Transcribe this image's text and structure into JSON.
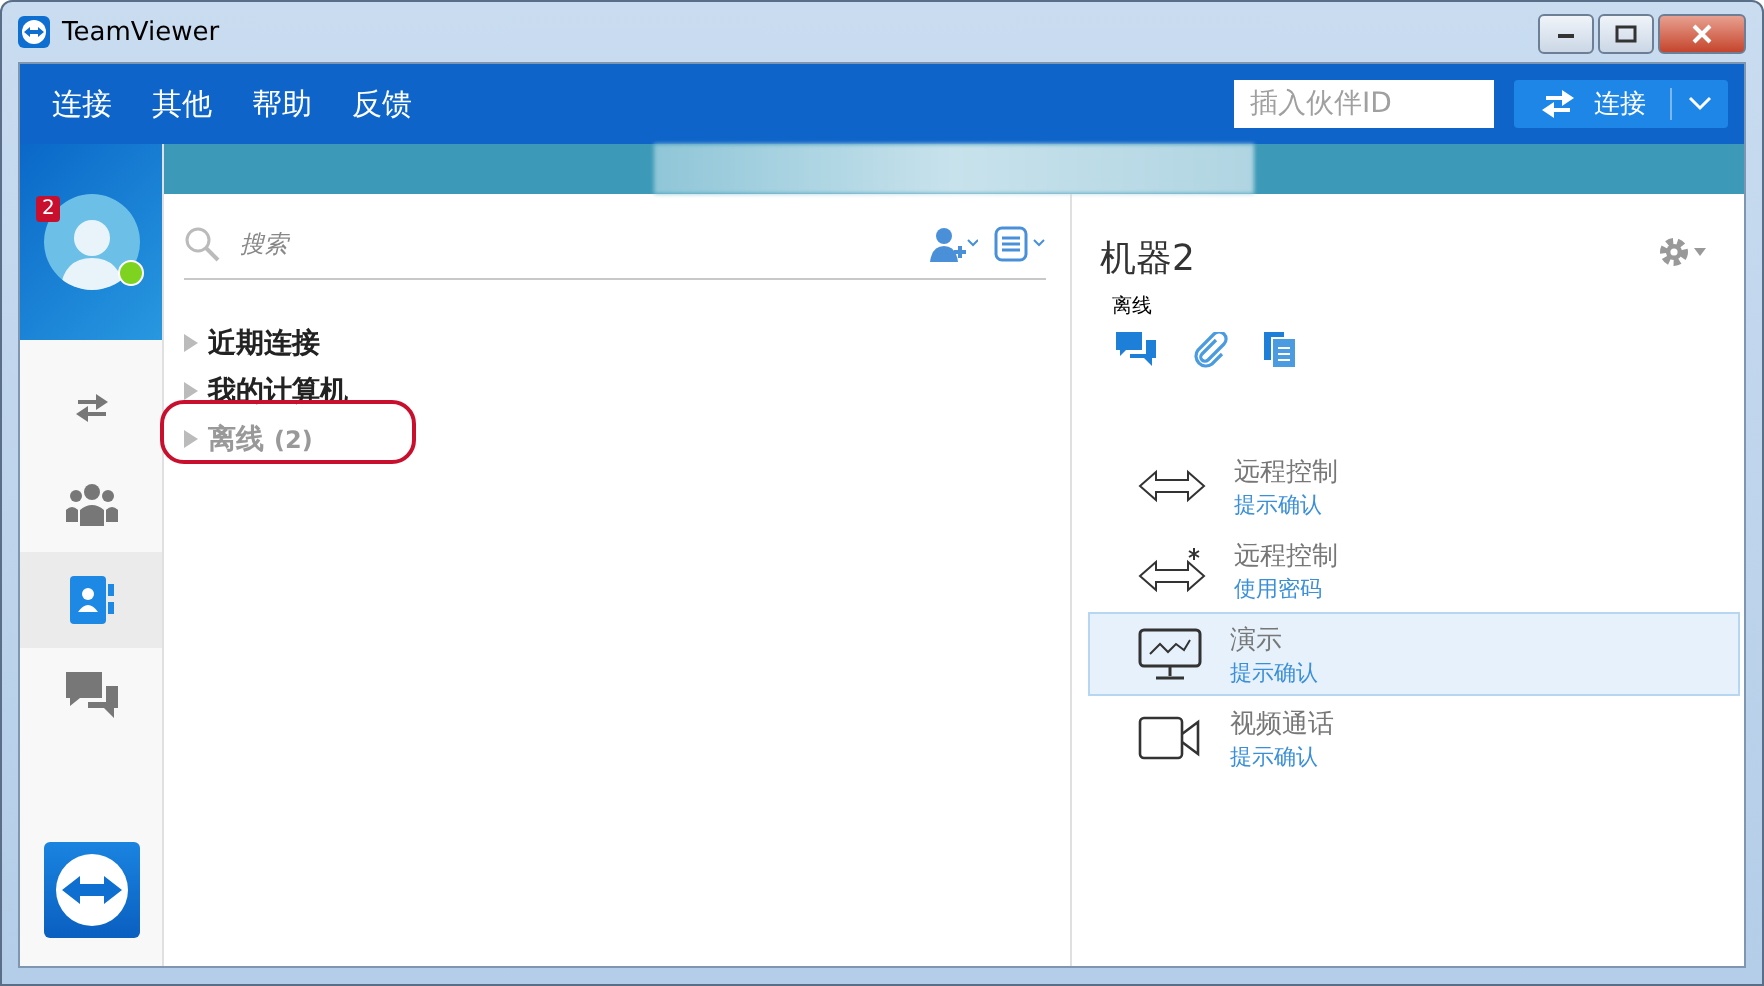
{
  "window": {
    "title": "TeamViewer"
  },
  "menu": [
    "连接",
    "其他",
    "帮助",
    "反馈"
  ],
  "partner_id": {
    "placeholder": "插入伙伴ID"
  },
  "connect_button": {
    "label": "连接"
  },
  "profile": {
    "badge": "2",
    "online": true
  },
  "nav": [
    {
      "kind": "remote",
      "selected": false
    },
    {
      "kind": "meeting",
      "selected": false
    },
    {
      "kind": "contacts",
      "selected": true
    },
    {
      "kind": "chat",
      "selected": false
    }
  ],
  "search": {
    "placeholder": "搜索"
  },
  "groups": [
    {
      "label": "近期连接",
      "disabled": false,
      "circled": false
    },
    {
      "label": "我的计算机",
      "disabled": false,
      "circled": false
    },
    {
      "label": "离线",
      "count": "(2)",
      "disabled": true,
      "circled": true
    }
  ],
  "device": {
    "name": "机器2",
    "status": "离线"
  },
  "actions": [
    {
      "kind": "remote",
      "title": "远程控制",
      "subtitle": "提示确认",
      "selected": false
    },
    {
      "kind": "remote-password",
      "title": "远程控制",
      "subtitle": "使用密码",
      "selected": false
    },
    {
      "kind": "presentation",
      "title": "演示",
      "subtitle": "提示确认",
      "selected": true
    },
    {
      "kind": "video",
      "title": "视频通话",
      "subtitle": "提示确认",
      "selected": false
    }
  ]
}
